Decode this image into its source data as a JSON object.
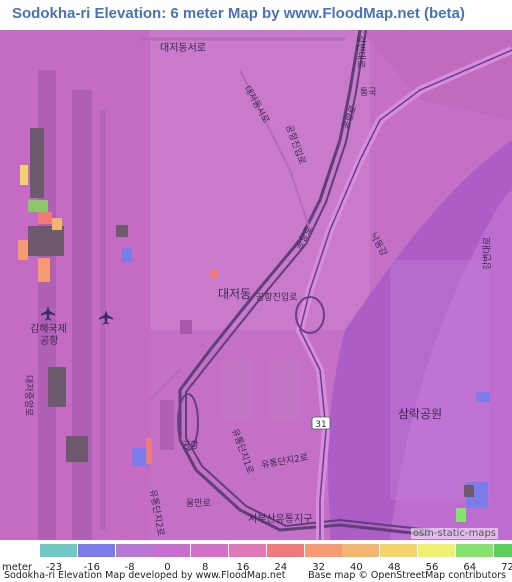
{
  "title": "Sodokha-ri Elevation: 6 meter Map by www.FloodMap.net (beta)",
  "map": {
    "labels": {
      "street_top": "대저동서로",
      "street_diag_1": "공항진입로",
      "street_diag_2": "대저동서로",
      "airport_name": "김해국제",
      "airport_name_2": "공항",
      "district": "대저동",
      "road_junction": "공항진입로",
      "park": "삼락공원",
      "river_label": "낙동강",
      "road_left": "공항로",
      "road_center": "공항로",
      "industrial_name": "서부산유통지구",
      "bottom_road": "유통단지1로",
      "bottom_road_2": "울만로",
      "bottom_road_3": "유통단지2로",
      "bottom_road_4": "유통단지2로",
      "bridge": "통국",
      "right_road": "강변대로",
      "left_road_2": "대저중앙로",
      "road_route": "31",
      "airport_label_2": "공항",
      "road_vert": "강변대로"
    },
    "icons": [
      "airplane-icon",
      "airplane-icon"
    ],
    "attribution": "osm-static-maps"
  },
  "legend": {
    "unit": "meter",
    "ticks": [
      "-23",
      "-16",
      "-8",
      "0",
      "8",
      "16",
      "24",
      "32",
      "40",
      "48",
      "56",
      "64",
      "72"
    ],
    "colors": [
      "#6ec9c4",
      "#7b7bea",
      "#b878d8",
      "#c86ed0",
      "#d270c8",
      "#e078b8",
      "#f07a7a",
      "#f49b74",
      "#f4b66e",
      "#f2d46a",
      "#eef070",
      "#86e46e",
      "#5ad05a"
    ]
  },
  "footer": {
    "left": "Sodokha-ri Elevation Map developed by www.FloodMap.net",
    "right": "Base map © OpenStreetMap contributors"
  }
}
